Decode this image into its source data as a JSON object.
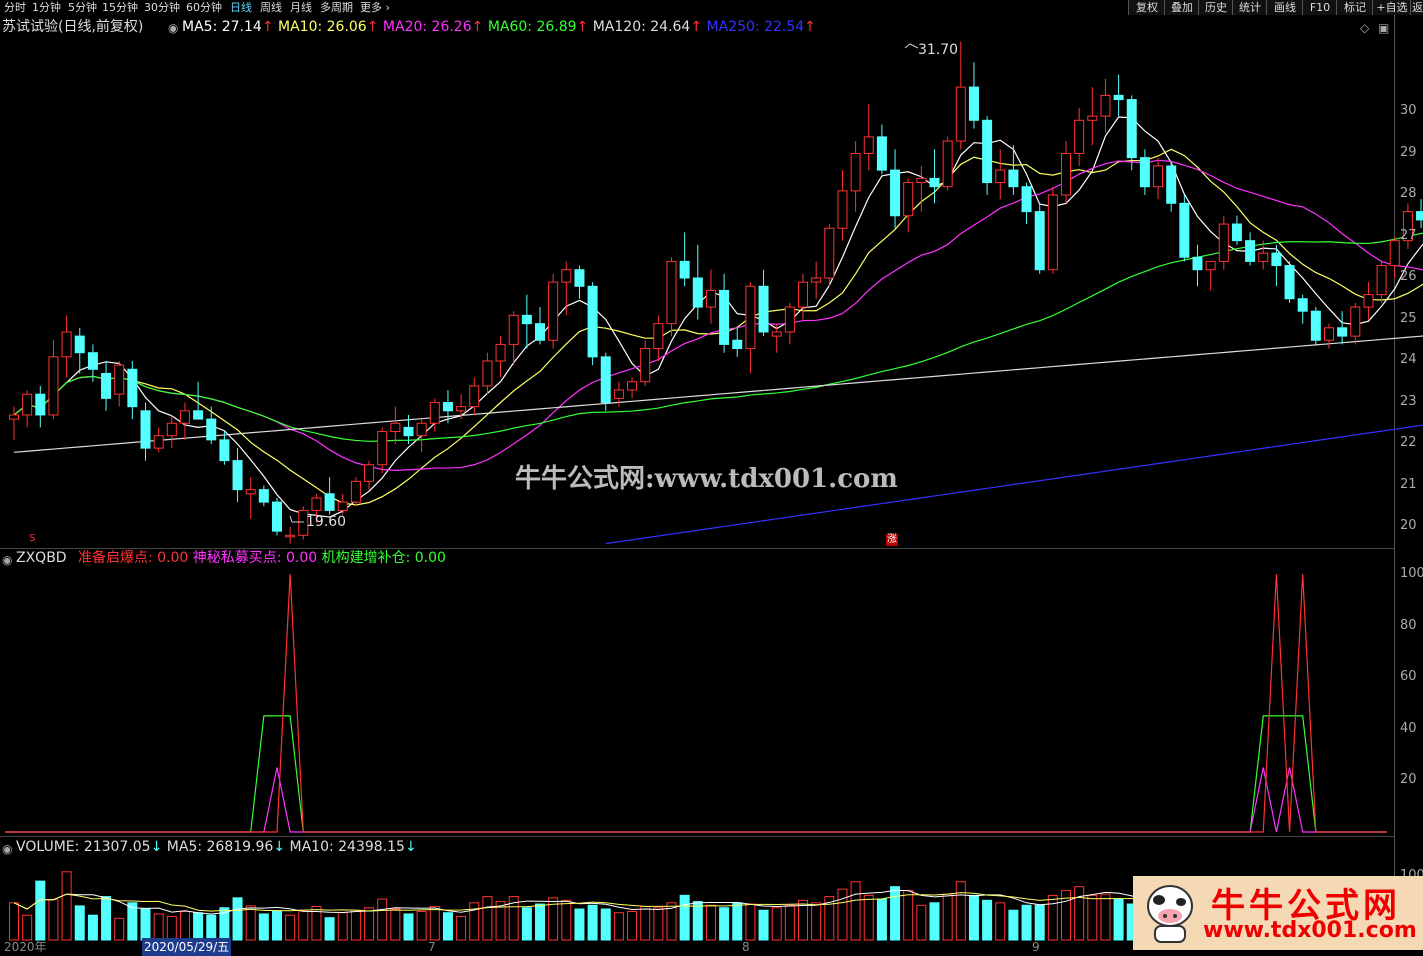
{
  "toolbar": {
    "periods": [
      "分时",
      "1分钟",
      "5分钟",
      "15分钟",
      "30分钟",
      "60分钟",
      "日线",
      "周线",
      "月线",
      "多周期",
      "更多"
    ],
    "active_period": "日线",
    "right_buttons": [
      "复权",
      "叠加",
      "历史",
      "统计",
      "画线",
      "F10",
      "标记",
      "+自选",
      "返"
    ]
  },
  "main": {
    "title": "苏试试验(日线,前复权)",
    "ma": [
      {
        "label": "MA5: 27.14",
        "color": "#ffffff"
      },
      {
        "label": "MA10: 26.06",
        "color": "#ffff66"
      },
      {
        "label": "MA20: 26.26",
        "color": "#ff33ff"
      },
      {
        "label": "MA60: 26.89",
        "color": "#33ff33"
      },
      {
        "label": "MA120: 24.64",
        "color": "#dddddd"
      },
      {
        "label": "MA250: 22.54",
        "color": "#3333ff"
      }
    ],
    "up_arrow": "↑",
    "high_label": "31.70",
    "low_label": "19.60",
    "price_axis": [
      "30",
      "29",
      "28",
      "27",
      "26",
      "25",
      "24",
      "23",
      "22",
      "21",
      "20"
    ],
    "marker_s": "S",
    "marker_zhang": "涨"
  },
  "indicator": {
    "name": "ZXQBD",
    "lines": [
      {
        "label": "准备启爆点: 0.00",
        "color": "#ff3333"
      },
      {
        "label": "神秘私募买点: 0.00",
        "color": "#ff33ff"
      },
      {
        "label": "机构建增补仓: 0.00",
        "color": "#33ff33"
      }
    ],
    "axis": [
      "100",
      "80",
      "60",
      "40",
      "20"
    ]
  },
  "volume": {
    "items": [
      {
        "label": "VOLUME: 21307.05",
        "color": "#dddddd"
      },
      {
        "label": "MA5: 26819.96",
        "color": "#dddddd"
      },
      {
        "label": "MA10: 24398.15",
        "color": "#dddddd"
      }
    ],
    "down_arrow": "↓",
    "axis_top": "100"
  },
  "dates": {
    "year": "2020年",
    "selected": "2020/05/29/五",
    "m7": "7",
    "m8": "8",
    "m9": "9"
  },
  "watermark": "牛牛公式网:www.tdx001.com",
  "logo": {
    "title": "牛牛公式网",
    "url": "www.tdx001.com"
  },
  "colors": {
    "up": "#ff3232",
    "down": "#54ffff",
    "ma5": "#ffffff",
    "ma10": "#ffff66",
    "ma20": "#ff33ff",
    "ma60": "#33ff33",
    "ma120": "#dddddd",
    "ma250": "#3333ff"
  },
  "chart_data": {
    "type": "candlestick",
    "ohlc": [
      [
        22.6,
        22.9,
        22.1,
        22.7
      ],
      [
        22.7,
        23.3,
        22.4,
        23.2
      ],
      [
        23.2,
        23.4,
        22.4,
        22.7
      ],
      [
        22.7,
        24.5,
        22.6,
        24.1
      ],
      [
        24.1,
        25.1,
        23.6,
        24.7
      ],
      [
        24.6,
        24.8,
        23.7,
        24.2
      ],
      [
        24.2,
        24.4,
        23.5,
        23.8
      ],
      [
        23.7,
        24.0,
        22.8,
        23.1
      ],
      [
        23.2,
        24.0,
        22.9,
        23.9
      ],
      [
        23.8,
        24.0,
        22.6,
        22.9
      ],
      [
        22.8,
        23.0,
        21.6,
        21.9
      ],
      [
        21.9,
        22.4,
        21.8,
        22.2
      ],
      [
        22.2,
        22.7,
        21.9,
        22.5
      ],
      [
        22.5,
        23.0,
        22.1,
        22.8
      ],
      [
        22.8,
        23.5,
        22.6,
        22.6
      ],
      [
        22.6,
        22.9,
        22.0,
        22.1
      ],
      [
        22.1,
        22.3,
        21.5,
        21.6
      ],
      [
        21.6,
        21.9,
        20.6,
        20.9
      ],
      [
        20.8,
        21.2,
        20.2,
        20.9
      ],
      [
        20.9,
        21.0,
        20.5,
        20.6
      ],
      [
        20.6,
        20.7,
        19.8,
        19.9
      ],
      [
        19.8,
        20.0,
        19.6,
        19.8
      ],
      [
        19.8,
        20.5,
        19.7,
        20.4
      ],
      [
        20.4,
        20.8,
        20.1,
        20.7
      ],
      [
        20.8,
        21.2,
        20.3,
        20.4
      ],
      [
        20.4,
        20.8,
        20.3,
        20.6
      ],
      [
        20.6,
        21.2,
        20.5,
        21.1
      ],
      [
        21.1,
        21.6,
        20.9,
        21.5
      ],
      [
        21.5,
        22.4,
        21.3,
        22.3
      ],
      [
        22.3,
        22.9,
        22.0,
        22.5
      ],
      [
        22.4,
        22.7,
        22.0,
        22.2
      ],
      [
        22.2,
        22.6,
        21.8,
        22.5
      ],
      [
        22.5,
        23.1,
        22.3,
        23.0
      ],
      [
        23.0,
        23.3,
        22.5,
        22.8
      ],
      [
        22.8,
        23.2,
        22.6,
        22.9
      ],
      [
        22.9,
        23.6,
        22.7,
        23.4
      ],
      [
        23.4,
        24.2,
        23.2,
        24.0
      ],
      [
        24.0,
        24.6,
        23.6,
        24.4
      ],
      [
        24.4,
        25.2,
        23.9,
        25.1
      ],
      [
        25.1,
        25.6,
        24.3,
        24.9
      ],
      [
        24.9,
        25.3,
        24.4,
        24.5
      ],
      [
        24.5,
        26.1,
        24.3,
        25.9
      ],
      [
        25.9,
        26.4,
        25.1,
        26.2
      ],
      [
        26.2,
        26.3,
        25.5,
        25.8
      ],
      [
        25.8,
        25.9,
        23.9,
        24.1
      ],
      [
        24.1,
        24.2,
        22.8,
        23.0
      ],
      [
        23.1,
        23.5,
        22.9,
        23.3
      ],
      [
        23.3,
        23.6,
        23.1,
        23.5
      ],
      [
        23.5,
        24.5,
        23.4,
        24.3
      ],
      [
        24.3,
        25.1,
        24.0,
        24.9
      ],
      [
        24.9,
        26.5,
        24.6,
        26.4
      ],
      [
        26.4,
        27.1,
        25.8,
        26.0
      ],
      [
        26.0,
        26.8,
        25.0,
        25.3
      ],
      [
        25.3,
        26.2,
        24.9,
        25.7
      ],
      [
        25.7,
        26.1,
        24.2,
        24.4
      ],
      [
        24.5,
        24.8,
        24.1,
        24.3
      ],
      [
        24.3,
        25.9,
        23.7,
        25.8
      ],
      [
        25.8,
        26.2,
        24.6,
        24.7
      ],
      [
        24.6,
        24.9,
        24.2,
        24.7
      ],
      [
        24.7,
        25.4,
        24.4,
        25.3
      ],
      [
        25.3,
        26.1,
        25.0,
        25.9
      ],
      [
        25.9,
        26.4,
        25.5,
        26.0
      ],
      [
        26.0,
        27.3,
        25.8,
        27.2
      ],
      [
        27.2,
        28.6,
        26.9,
        28.1
      ],
      [
        28.1,
        29.3,
        27.6,
        29.0
      ],
      [
        29.0,
        30.2,
        28.6,
        29.4
      ],
      [
        29.4,
        29.7,
        28.5,
        28.6
      ],
      [
        28.6,
        29.1,
        27.2,
        27.5
      ],
      [
        27.5,
        28.4,
        27.1,
        28.3
      ],
      [
        28.3,
        28.7,
        27.6,
        28.4
      ],
      [
        28.4,
        29.1,
        27.8,
        28.2
      ],
      [
        28.2,
        29.4,
        28.1,
        29.3
      ],
      [
        29.3,
        31.7,
        29.1,
        30.6
      ],
      [
        30.6,
        31.2,
        29.6,
        29.8
      ],
      [
        29.8,
        29.9,
        28.0,
        28.3
      ],
      [
        28.3,
        29.1,
        27.9,
        28.6
      ],
      [
        28.6,
        29.2,
        28.0,
        28.2
      ],
      [
        28.2,
        28.3,
        27.3,
        27.6
      ],
      [
        27.6,
        27.8,
        26.1,
        26.2
      ],
      [
        26.2,
        28.2,
        26.1,
        28.0
      ],
      [
        28.0,
        29.3,
        27.8,
        29.0
      ],
      [
        29.0,
        30.1,
        28.7,
        29.8
      ],
      [
        29.8,
        30.6,
        29.2,
        29.9
      ],
      [
        29.9,
        30.8,
        29.5,
        30.4
      ],
      [
        30.4,
        30.9,
        29.9,
        30.3
      ],
      [
        30.3,
        30.4,
        28.6,
        28.9
      ],
      [
        28.9,
        29.1,
        28.0,
        28.2
      ],
      [
        28.2,
        28.9,
        27.9,
        28.7
      ],
      [
        28.7,
        28.8,
        27.6,
        27.8
      ],
      [
        27.8,
        28.0,
        26.4,
        26.5
      ],
      [
        26.5,
        26.8,
        25.8,
        26.2
      ],
      [
        26.2,
        26.4,
        25.7,
        26.4
      ],
      [
        26.4,
        27.5,
        26.2,
        27.3
      ],
      [
        27.3,
        27.5,
        26.8,
        26.9
      ],
      [
        26.9,
        27.1,
        26.3,
        26.4
      ],
      [
        26.4,
        26.9,
        26.2,
        26.6
      ],
      [
        26.6,
        26.8,
        25.8,
        26.3
      ],
      [
        26.3,
        26.4,
        25.4,
        25.5
      ],
      [
        25.5,
        25.6,
        24.9,
        25.2
      ],
      [
        25.2,
        25.3,
        24.4,
        24.5
      ],
      [
        24.5,
        24.9,
        24.3,
        24.8
      ],
      [
        24.8,
        25.2,
        24.4,
        24.6
      ],
      [
        24.6,
        25.4,
        24.4,
        25.3
      ],
      [
        25.3,
        25.9,
        25.0,
        25.6
      ],
      [
        25.6,
        26.4,
        25.4,
        26.3
      ],
      [
        26.3,
        27.0,
        26.0,
        26.9
      ],
      [
        26.9,
        27.8,
        26.7,
        27.6
      ],
      [
        27.6,
        27.9,
        27.2,
        27.4
      ],
      [
        27.4,
        28.2,
        27.1,
        27.3
      ],
      [
        27.3,
        27.6,
        26.9,
        27.1
      ]
    ],
    "signals": {
      "red": [
        {
          "i": 21,
          "v": 100
        },
        {
          "i": 96,
          "v": 100
        },
        {
          "i": 98,
          "v": 100
        }
      ],
      "magenta": [
        {
          "i": 20,
          "v": 25
        },
        {
          "i": 95,
          "v": 25
        },
        {
          "i": 97,
          "v": 25
        }
      ],
      "green_plateau": [
        {
          "from": 19,
          "to": 21,
          "v": 45
        },
        {
          "from": 95,
          "to": 98,
          "v": 45
        }
      ]
    },
    "volume": [
      60,
      40,
      95,
      65,
      110,
      55,
      40,
      70,
      35,
      60,
      50,
      42,
      38,
      46,
      44,
      40,
      52,
      68,
      55,
      42,
      46,
      40,
      48,
      54,
      36,
      44,
      48,
      52,
      66,
      50,
      42,
      46,
      54,
      44,
      38,
      60,
      70,
      62,
      70,
      52,
      58,
      68,
      64,
      50,
      56,
      50,
      44,
      46,
      54,
      52,
      60,
      72,
      62,
      56,
      52,
      60,
      58,
      48,
      52,
      56,
      64,
      60,
      70,
      82,
      94,
      72,
      66,
      86,
      80,
      56,
      60,
      74,
      94,
      72,
      64,
      60,
      48,
      56,
      56,
      72,
      80,
      86,
      72,
      74,
      66,
      58,
      54,
      44,
      50,
      56,
      46,
      40,
      42,
      46,
      50,
      44,
      40,
      42,
      36,
      32,
      46,
      48,
      54,
      58,
      62,
      68,
      60,
      50,
      42,
      38
    ]
  }
}
